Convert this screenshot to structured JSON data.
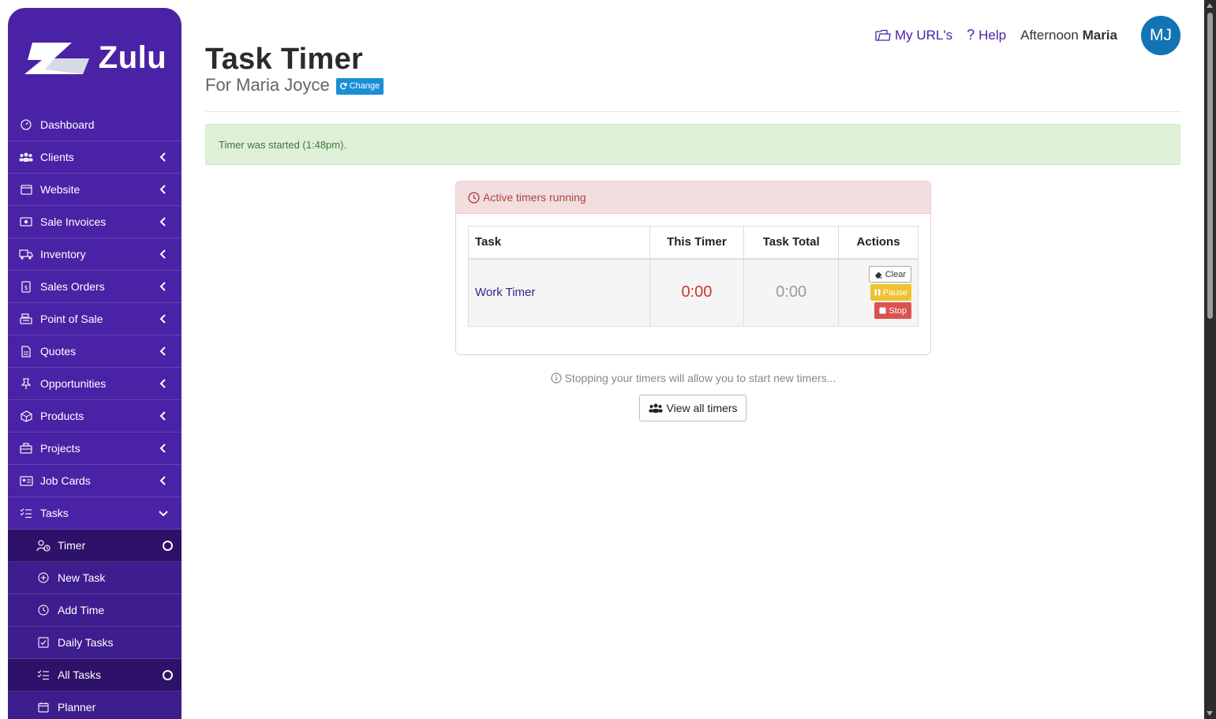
{
  "app": {
    "logo_text": "Zulu"
  },
  "sidebar": {
    "items": [
      {
        "label": "Dashboard",
        "icon": "gauge-icon"
      },
      {
        "label": "Clients",
        "icon": "users-icon"
      },
      {
        "label": "Website",
        "icon": "window-icon"
      },
      {
        "label": "Sale Invoices",
        "icon": "money-icon"
      },
      {
        "label": "Inventory",
        "icon": "truck-icon"
      },
      {
        "label": "Sales Orders",
        "icon": "invoice-icon"
      },
      {
        "label": "Point of Sale",
        "icon": "cash-register-icon"
      },
      {
        "label": "Quotes",
        "icon": "document-icon"
      },
      {
        "label": "Opportunities",
        "icon": "pin-icon"
      },
      {
        "label": "Products",
        "icon": "box-icon"
      },
      {
        "label": "Projects",
        "icon": "briefcase-icon"
      },
      {
        "label": "Job Cards",
        "icon": "id-card-icon"
      },
      {
        "label": "Tasks",
        "icon": "tasks-icon"
      }
    ],
    "subitems": [
      {
        "label": "Timer",
        "icon": "user-clock-icon"
      },
      {
        "label": "New Task",
        "icon": "plus-circle-icon"
      },
      {
        "label": "Add Time",
        "icon": "clock-icon"
      },
      {
        "label": "Daily Tasks",
        "icon": "checkbox-icon"
      },
      {
        "label": "All Tasks",
        "icon": "list-check-icon"
      },
      {
        "label": "Planner",
        "icon": "calendar-icon"
      }
    ]
  },
  "header": {
    "title": "Task Timer",
    "subtitle": "For Maria Joyce",
    "change_label": "Change",
    "my_urls": "My URL's",
    "help": "Help",
    "greeting": "Afternoon",
    "user_first": "Maria",
    "avatar_initials": "MJ"
  },
  "alert": {
    "text": "Timer was started (1:48pm)."
  },
  "panel": {
    "heading": "Active timers running",
    "columns": [
      "Task",
      "This Timer",
      "Task Total",
      "Actions"
    ],
    "rows": [
      {
        "task": "Work Timer",
        "this_timer": "0:00",
        "task_total": "0:00"
      }
    ],
    "actions": {
      "clear": "Clear",
      "pause": "Pause",
      "stop": "Stop"
    }
  },
  "info_text": "Stopping your timers will allow you to start new timers...",
  "view_all_label": "View all timers",
  "colors": {
    "sidebar": "#4a22a6",
    "accent": "#1a8ed6",
    "alert_bg": "#dff0d8",
    "danger": "#d9534f",
    "warning": "#f0c230"
  }
}
